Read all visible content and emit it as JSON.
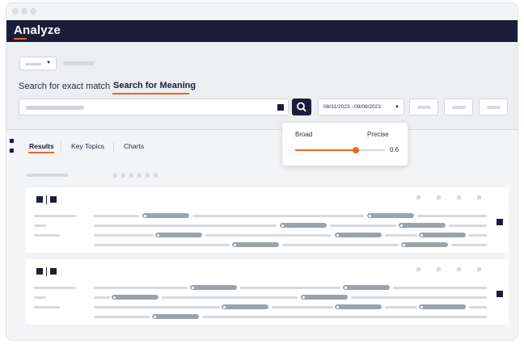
{
  "app": {
    "brand": "Analyze"
  },
  "colors": {
    "navy": "#1b1d3b",
    "accent": "#e8662a",
    "placeholder": "#d6d9de",
    "pill": "#9ba3ac"
  },
  "search_modes": {
    "exact": "Search for exact match",
    "meaning": "Search for Meaning",
    "active": "meaning"
  },
  "search": {
    "icon": "search-icon"
  },
  "date_range": {
    "label": "08/31/2023 - 09/09/2023",
    "icon": "chevron-down-icon"
  },
  "tabs": [
    {
      "label": "Results",
      "active": true
    },
    {
      "label": "Key Topics",
      "active": false
    },
    {
      "label": "Charts",
      "active": false
    }
  ],
  "precision": {
    "left_label": "Broad",
    "right_label": "Precise",
    "value": 0.6,
    "value_text": "0.6"
  },
  "results": {
    "card_count": 2
  }
}
